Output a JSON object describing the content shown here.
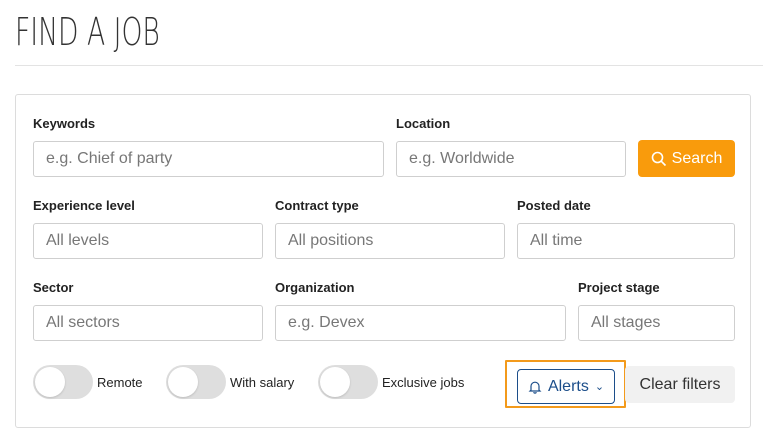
{
  "page": {
    "title": "FIND A JOB"
  },
  "filters": {
    "keywords": {
      "label": "Keywords",
      "placeholder": "e.g. Chief of party"
    },
    "location": {
      "label": "Location",
      "placeholder": "e.g. Worldwide"
    },
    "search_button": {
      "label": "Search",
      "icon": "search-icon",
      "color": "#f99b0c"
    },
    "experience": {
      "label": "Experience level",
      "value": "All levels"
    },
    "contract": {
      "label": "Contract type",
      "value": "All positions"
    },
    "posted": {
      "label": "Posted date",
      "value": "All time"
    },
    "sector": {
      "label": "Sector",
      "value": "All sectors"
    },
    "organization": {
      "label": "Organization",
      "placeholder": "e.g. Devex"
    },
    "project_stage": {
      "label": "Project stage",
      "value": "All stages"
    }
  },
  "toggles": [
    {
      "label": "Remote",
      "on": false
    },
    {
      "label": "With salary",
      "on": false
    },
    {
      "label": "Exclusive jobs",
      "on": false
    }
  ],
  "actions": {
    "alerts": {
      "label": "Alerts",
      "icon": "bell-icon",
      "color": "#1c4e8a",
      "highlight": "#f39a1b"
    },
    "clear": {
      "label": "Clear filters"
    }
  }
}
